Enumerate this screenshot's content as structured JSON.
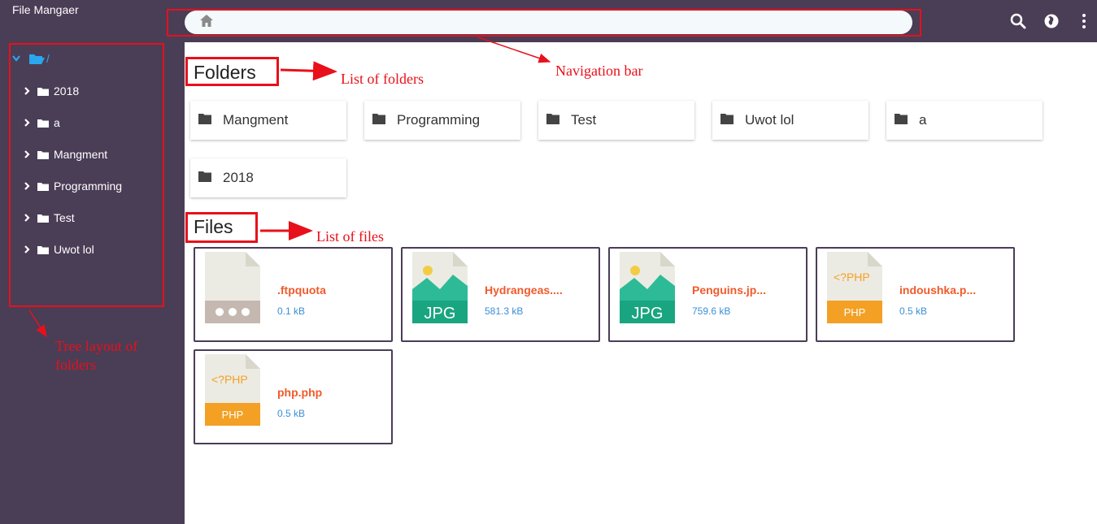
{
  "app": {
    "title": "File Mangaer"
  },
  "navbar": {
    "home_icon": "home-icon",
    "path": ""
  },
  "toolbar": {
    "icons": [
      "search-icon",
      "globe-icon",
      "more-vert-icon"
    ]
  },
  "tree": {
    "root_label": "/",
    "items": [
      {
        "label": "2018"
      },
      {
        "label": "a"
      },
      {
        "label": "Mangment"
      },
      {
        "label": "Programming"
      },
      {
        "label": "Test"
      },
      {
        "label": "Uwot lol"
      }
    ]
  },
  "folders": {
    "title": "Folders",
    "items": [
      {
        "name": "Mangment"
      },
      {
        "name": "Programming"
      },
      {
        "name": "Test"
      },
      {
        "name": "Uwot lol"
      },
      {
        "name": "a"
      },
      {
        "name": "2018"
      }
    ]
  },
  "files": {
    "title": "Files",
    "items": [
      {
        "name": ".ftpquota",
        "size": "0.1 kB",
        "type": "generic"
      },
      {
        "name": "Hydrangeas....",
        "size": "581.3 kB",
        "type": "JPG"
      },
      {
        "name": "Penguins.jp...",
        "size": "759.6 kB",
        "type": "JPG"
      },
      {
        "name": "indoushka.p...",
        "size": "0.5 kB",
        "type": "PHP",
        "code": "<?PHP"
      },
      {
        "name": "php.php",
        "size": "0.5 kB",
        "type": "PHP",
        "code": "<?PHP"
      }
    ]
  },
  "annotations": {
    "navigation_bar": "Navigation bar",
    "list_of_folders": "List of folders",
    "list_of_files": "List of files",
    "tree_layout_line1": "Tree layout of",
    "tree_layout_line2": "folders"
  },
  "colors": {
    "sidebar": "#4a3d56",
    "annotation": "#e8101a",
    "file_name": "#f15a2b",
    "file_size": "#3a8fd6",
    "jpg": "#24b08e",
    "php": "#f3a024"
  }
}
